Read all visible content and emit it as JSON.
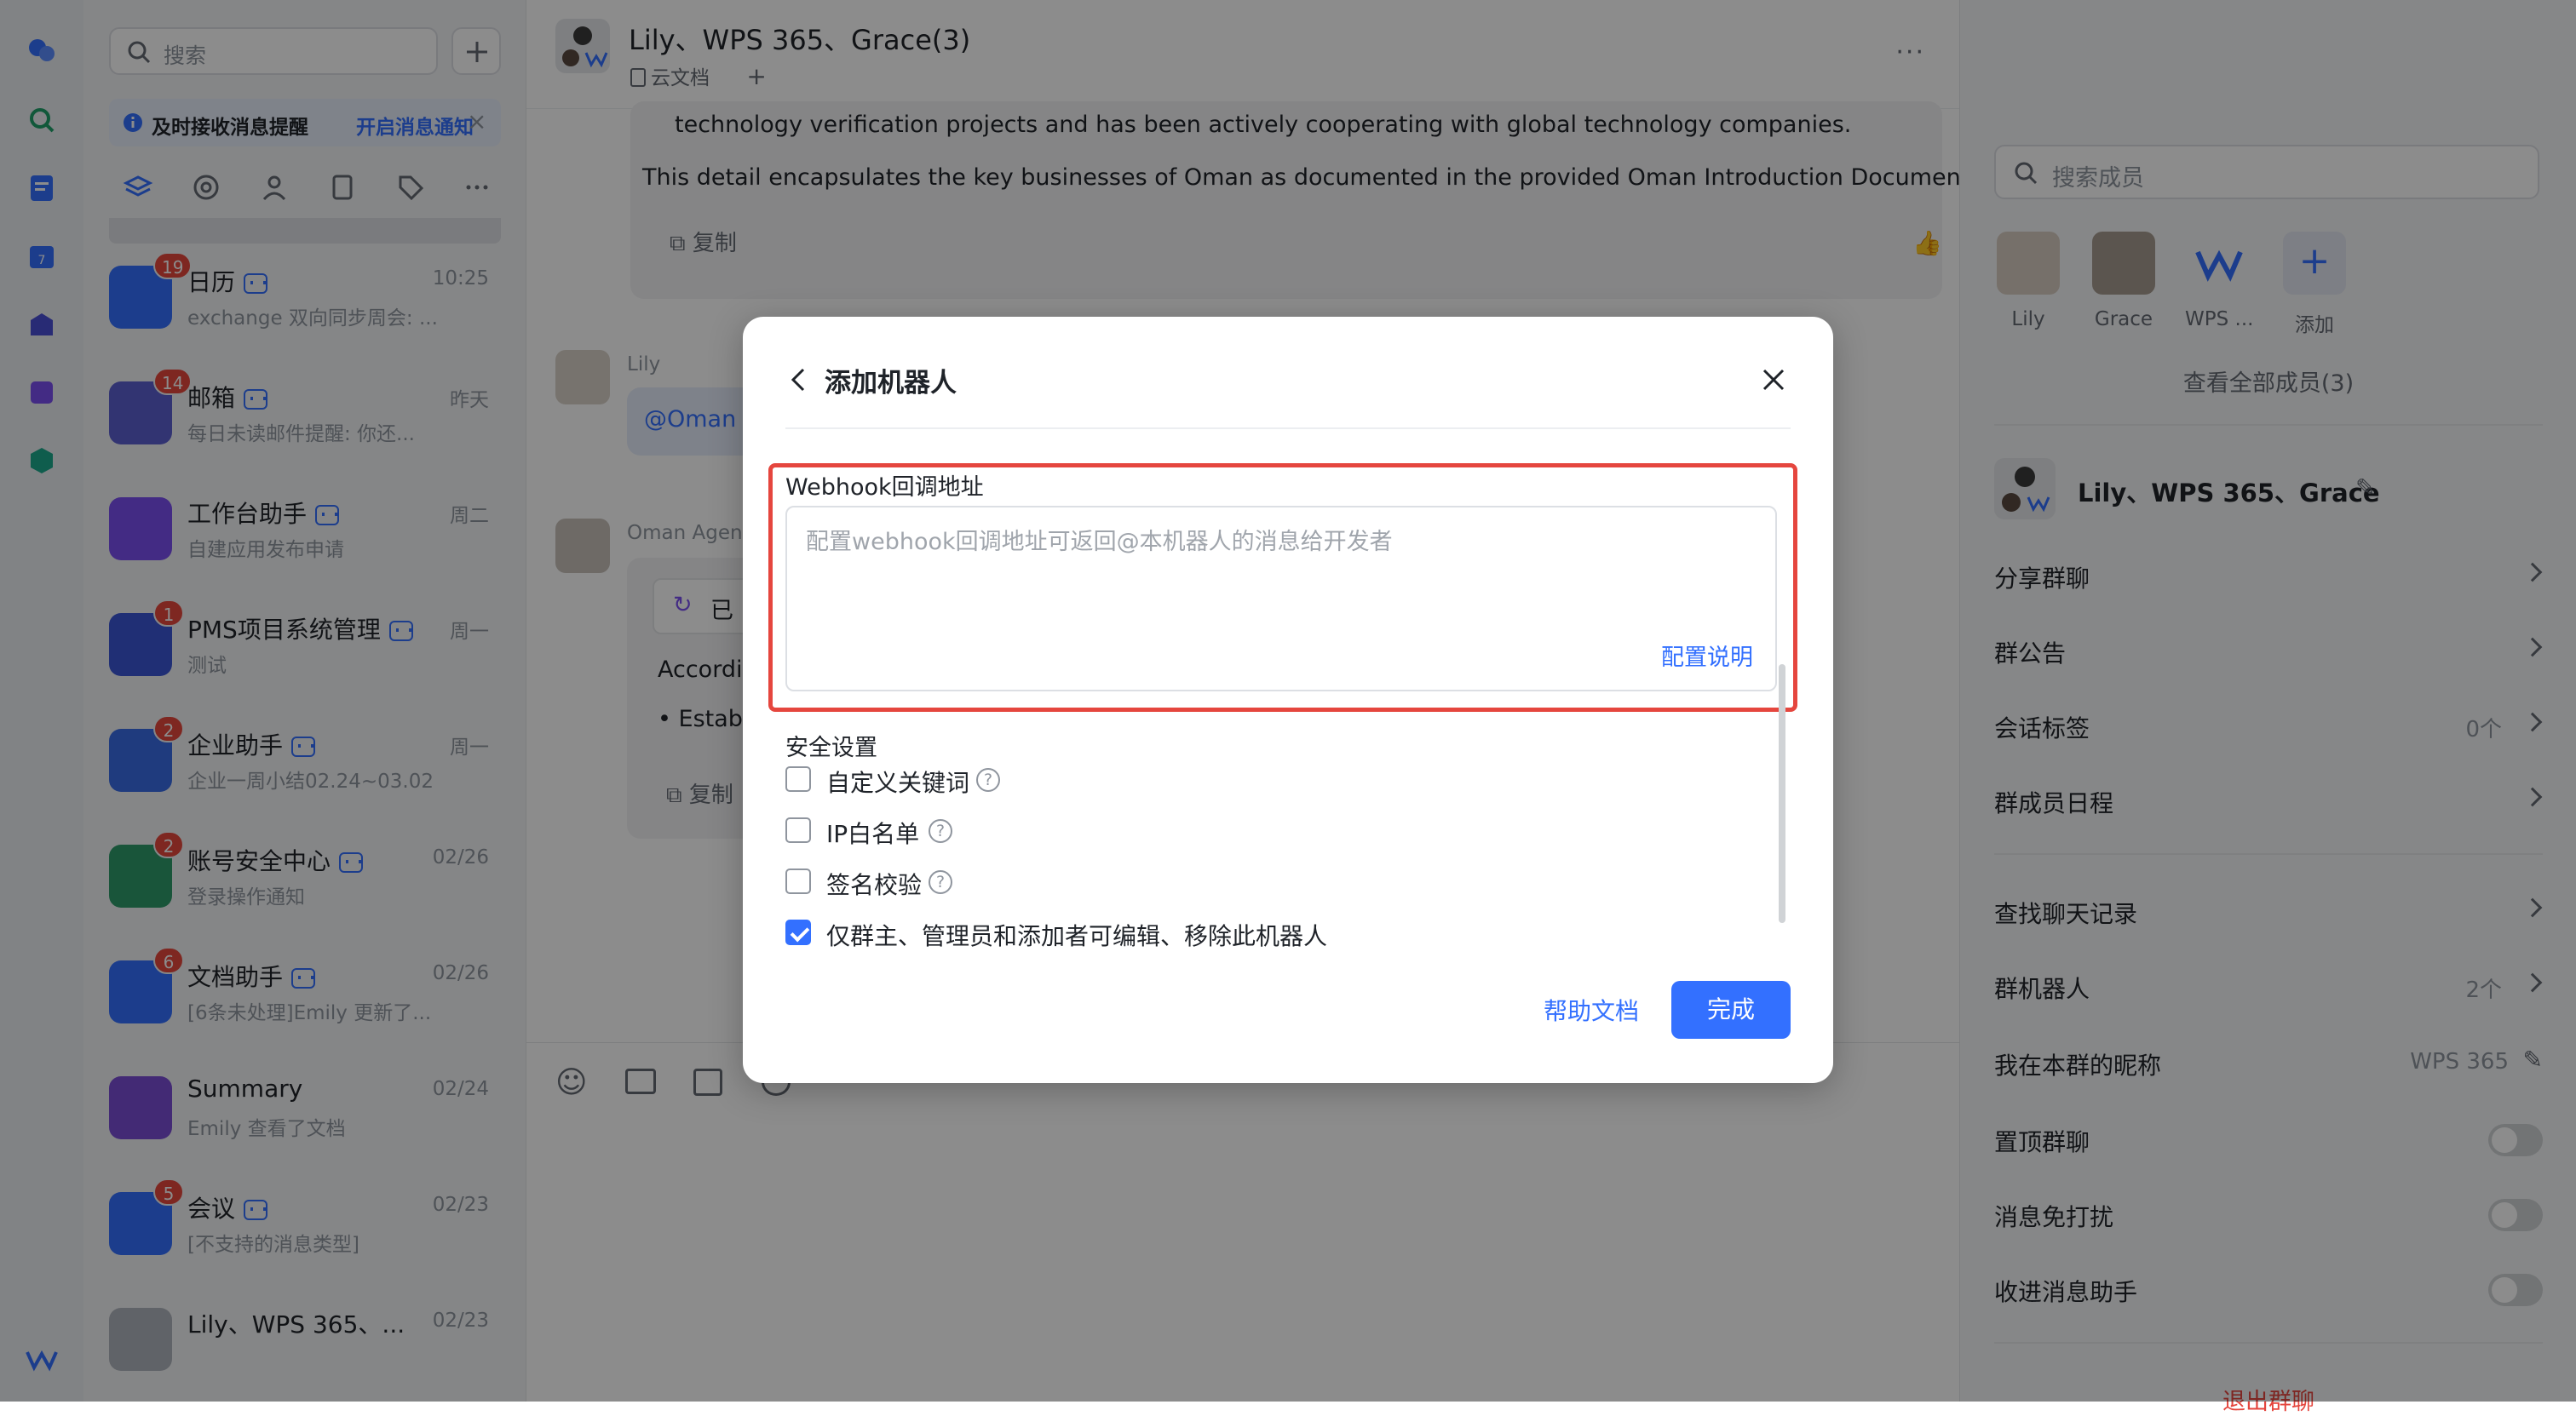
{
  "chat_list": {
    "search_placeholder": "搜索",
    "notify": {
      "text": "及时接收消息提醒",
      "action": "开启消息通知"
    },
    "items": [
      {
        "name": "日历",
        "time": "10:25",
        "preview": "exchange 双向同步周会: ...",
        "badge": "19",
        "color": "#3370ff"
      },
      {
        "name": "邮箱",
        "time": "昨天",
        "preview": "每日未读邮件提醒: 你还...",
        "badge": "14",
        "color": "#5b5fcf"
      },
      {
        "name": "工作台助手",
        "time": "周二",
        "preview": "自建应用发布申请",
        "badge": "",
        "color": "#7a4ff0"
      },
      {
        "name": "PMS项目系统管理",
        "time": "周一",
        "preview": "测试",
        "badge": "1",
        "color": "#3b57d6"
      },
      {
        "name": "企业助手",
        "time": "周一",
        "preview": "企业一周小结02.24~03.02",
        "badge": "2",
        "color": "#3a6ce6"
      },
      {
        "name": "账号安全中心",
        "time": "02/26",
        "preview": "登录操作通知",
        "badge": "2",
        "color": "#2e9b6b"
      },
      {
        "name": "文档助手",
        "time": "02/26",
        "preview": "[6条未处理]Emily 更新了...",
        "badge": "6",
        "color": "#3370ff"
      },
      {
        "name": "Summary",
        "time": "02/24",
        "preview": "Emily 查看了文档",
        "badge": "",
        "color": "#7b4dd6"
      },
      {
        "name": "会议",
        "time": "02/23",
        "preview": "[不支持的消息类型]",
        "badge": "5",
        "color": "#3370ff"
      },
      {
        "name": "Lily、WPS 365、...",
        "time": "02/23",
        "preview": "",
        "badge": "",
        "color": "#b0b5bd"
      }
    ]
  },
  "chat": {
    "title": "Lily、WPS 365、Grace(3)",
    "subtitle": "云文档",
    "msg_line1": "technology verification projects and has been actively cooperating with global technology companies.",
    "msg_line2": "This detail encapsulates the key businesses of Oman as documented in the provided Oman Introduction Document.",
    "copy_label": "复制",
    "sender_lily": "Lily",
    "lily_msg": "@Oman",
    "sender_agent": "Oman Agent",
    "agent_status": "已",
    "agent_text": "Accordin",
    "agent_bullet": "Estab",
    "copy_label_2": "复制"
  },
  "right_panel": {
    "search_placeholder": "搜索成员",
    "members": [
      "Lily",
      "Grace",
      "WPS ...",
      "添加"
    ],
    "view_all": "查看全部成员(3)",
    "group_name": "Lily、WPS 365、Grace",
    "rows": [
      {
        "label": "分享群聊",
        "value": ""
      },
      {
        "label": "群公告",
        "value": ""
      },
      {
        "label": "会话标签",
        "value": "0个"
      },
      {
        "label": "群成员日程",
        "value": ""
      },
      {
        "label": "查找聊天记录",
        "value": ""
      },
      {
        "label": "群机器人",
        "value": "2个"
      },
      {
        "label": "我在本群的昵称",
        "value": "WPS 365"
      }
    ],
    "toggles": [
      "置顶群聊",
      "消息免打扰",
      "收进消息助手"
    ],
    "exit": "退出群聊"
  },
  "modal": {
    "title": "添加机器人",
    "webhook_label": "Webhook回调地址",
    "webhook_placeholder": "配置webhook回调地址可返回@本机器人的消息给开发者",
    "config_link": "配置说明",
    "security_title": "安全设置",
    "options": [
      {
        "label": "自定义关键词",
        "checked": false,
        "help": true
      },
      {
        "label": "IP白名单",
        "checked": false,
        "help": true
      },
      {
        "label": "签名校验",
        "checked": false,
        "help": true
      },
      {
        "label": "仅群主、管理员和添加者可编辑、移除此机器人",
        "checked": true,
        "help": false
      }
    ],
    "help_link": "帮助文档",
    "done_button": "完成"
  }
}
